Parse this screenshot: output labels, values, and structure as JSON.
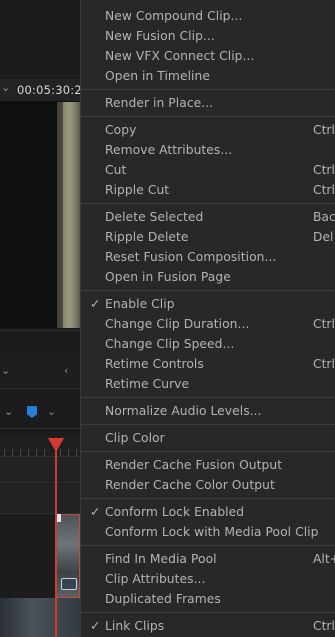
{
  "timeline": {
    "timecode": "00:05:30:2",
    "chevron_icon": "chevron-down-icon",
    "collapse_icon": "chevron-left-icon",
    "marker_color": "#2e7be0",
    "playhead_color": "#d53a2f"
  },
  "menu": {
    "groups": [
      [
        {
          "label": "New Compound Clip...",
          "shortcut": "",
          "checked": false
        },
        {
          "label": "New Fusion Clip...",
          "shortcut": "",
          "checked": false
        },
        {
          "label": "New VFX Connect Clip...",
          "shortcut": "",
          "checked": false
        },
        {
          "label": "Open in Timeline",
          "shortcut": "",
          "checked": false
        }
      ],
      [
        {
          "label": "Render in Place...",
          "shortcut": "",
          "checked": false
        }
      ],
      [
        {
          "label": "Copy",
          "shortcut": "Ctrl-",
          "checked": false
        },
        {
          "label": "Remove Attributes...",
          "shortcut": "",
          "checked": false
        },
        {
          "label": "Cut",
          "shortcut": "Ctrl-",
          "checked": false
        },
        {
          "label": "Ripple Cut",
          "shortcut": "Ctrl-",
          "checked": false
        }
      ],
      [
        {
          "label": "Delete Selected",
          "shortcut": "Bac",
          "checked": false
        },
        {
          "label": "Ripple Delete",
          "shortcut": "Del",
          "checked": false
        },
        {
          "label": "Reset Fusion Composition...",
          "shortcut": "",
          "checked": false
        },
        {
          "label": "Open in Fusion Page",
          "shortcut": "",
          "checked": false
        }
      ],
      [
        {
          "label": "Enable Clip",
          "shortcut": "",
          "checked": true
        },
        {
          "label": "Change Clip Duration...",
          "shortcut": "Ctrl-",
          "checked": false
        },
        {
          "label": "Change Clip Speed...",
          "shortcut": "",
          "checked": false
        },
        {
          "label": "Retime Controls",
          "shortcut": "Ctrl-",
          "checked": false
        },
        {
          "label": "Retime Curve",
          "shortcut": "",
          "checked": false
        }
      ],
      [
        {
          "label": "Normalize Audio Levels...",
          "shortcut": "",
          "checked": false
        }
      ],
      [
        {
          "label": "Clip Color",
          "shortcut": "",
          "checked": false
        }
      ],
      [
        {
          "label": "Render Cache Fusion Output",
          "shortcut": "",
          "checked": false
        },
        {
          "label": "Render Cache Color Output",
          "shortcut": "",
          "checked": false
        }
      ],
      [
        {
          "label": "Conform Lock Enabled",
          "shortcut": "",
          "checked": true
        },
        {
          "label": "Conform Lock with Media Pool Clip",
          "shortcut": "",
          "checked": false
        }
      ],
      [
        {
          "label": "Find In Media Pool",
          "shortcut": "Alt+",
          "checked": false
        },
        {
          "label": "Clip Attributes...",
          "shortcut": "",
          "checked": false
        },
        {
          "label": "Duplicated Frames",
          "shortcut": "",
          "checked": false
        }
      ],
      [
        {
          "label": "Link Clips",
          "shortcut": "Ctrl-",
          "checked": true
        }
      ]
    ],
    "check_glyph": "✓"
  }
}
